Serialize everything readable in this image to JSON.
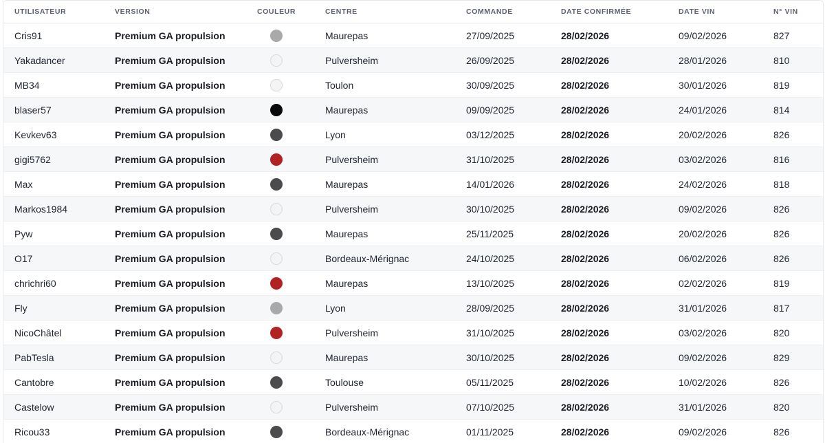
{
  "columns": {
    "utilisateur": "UTILISATEUR",
    "version": "VERSION",
    "couleur": "COULEUR",
    "centre": "CENTRE",
    "commande": "COMMANDE",
    "date_confirmee": "DATE CONFIRMÉE",
    "date_vin": "DATE VIN",
    "num_vin": "N° VIN"
  },
  "colors": {
    "argent": "#a9a9a9",
    "blanc": "#f4f4f4",
    "noir": "#0a0a0a",
    "gris": "#4b4b4d",
    "rouge": "#b22222"
  },
  "rows": [
    {
      "user": "Cris91",
      "version": "Premium GA propulsion",
      "color": "argent",
      "centre": "Maurepas",
      "commande": "27/09/2025",
      "confirmee": "28/02/2026",
      "date_vin": "09/02/2026",
      "vin": "827"
    },
    {
      "user": "Yakadancer",
      "version": "Premium GA propulsion",
      "color": "blanc",
      "centre": "Pulversheim",
      "commande": "26/09/2025",
      "confirmee": "28/02/2026",
      "date_vin": "28/01/2026",
      "vin": "810"
    },
    {
      "user": "MB34",
      "version": "Premium GA propulsion",
      "color": "blanc",
      "centre": "Toulon",
      "commande": "30/09/2025",
      "confirmee": "28/02/2026",
      "date_vin": "30/01/2026",
      "vin": "819"
    },
    {
      "user": "blaser57",
      "version": "Premium GA propulsion",
      "color": "noir",
      "centre": "Maurepas",
      "commande": "09/09/2025",
      "confirmee": "28/02/2026",
      "date_vin": "24/01/2026",
      "vin": "814"
    },
    {
      "user": "Kevkev63",
      "version": "Premium GA propulsion",
      "color": "gris",
      "centre": "Lyon",
      "commande": "03/12/2025",
      "confirmee": "28/02/2026",
      "date_vin": "20/02/2026",
      "vin": "826"
    },
    {
      "user": "gigi5762",
      "version": "Premium GA propulsion",
      "color": "rouge",
      "centre": "Pulversheim",
      "commande": "31/10/2025",
      "confirmee": "28/02/2026",
      "date_vin": "03/02/2026",
      "vin": "816"
    },
    {
      "user": "Max",
      "version": "Premium GA propulsion",
      "color": "gris",
      "centre": "Maurepas",
      "commande": "14/01/2026",
      "confirmee": "28/02/2026",
      "date_vin": "24/02/2026",
      "vin": "818"
    },
    {
      "user": "Markos1984",
      "version": "Premium GA propulsion",
      "color": "blanc",
      "centre": "Pulversheim",
      "commande": "30/10/2025",
      "confirmee": "28/02/2026",
      "date_vin": "09/02/2026",
      "vin": "826"
    },
    {
      "user": "Pyw",
      "version": "Premium GA propulsion",
      "color": "gris",
      "centre": "Maurepas",
      "commande": "25/11/2025",
      "confirmee": "28/02/2026",
      "date_vin": "20/02/2026",
      "vin": "826"
    },
    {
      "user": "O17",
      "version": "Premium GA propulsion",
      "color": "blanc",
      "centre": "Bordeaux-Mérignac",
      "commande": "24/10/2025",
      "confirmee": "28/02/2026",
      "date_vin": "06/02/2026",
      "vin": "826"
    },
    {
      "user": "chrichri60",
      "version": "Premium GA propulsion",
      "color": "rouge",
      "centre": "Maurepas",
      "commande": "13/10/2025",
      "confirmee": "28/02/2026",
      "date_vin": "02/02/2026",
      "vin": "819"
    },
    {
      "user": "Fly",
      "version": "Premium GA propulsion",
      "color": "argent",
      "centre": "Lyon",
      "commande": "28/09/2025",
      "confirmee": "28/02/2026",
      "date_vin": "31/01/2026",
      "vin": "817"
    },
    {
      "user": "NicoChâtel",
      "version": "Premium GA propulsion",
      "color": "rouge",
      "centre": "Pulversheim",
      "commande": "31/10/2025",
      "confirmee": "28/02/2026",
      "date_vin": "03/02/2026",
      "vin": "820"
    },
    {
      "user": "PabTesla",
      "version": "Premium GA propulsion",
      "color": "blanc",
      "centre": "Maurepas",
      "commande": "30/10/2025",
      "confirmee": "28/02/2026",
      "date_vin": "09/02/2026",
      "vin": "829"
    },
    {
      "user": "Cantobre",
      "version": "Premium GA propulsion",
      "color": "gris",
      "centre": "Toulouse",
      "commande": "05/11/2025",
      "confirmee": "28/02/2026",
      "date_vin": "10/02/2026",
      "vin": "826"
    },
    {
      "user": "Castelow",
      "version": "Premium GA propulsion",
      "color": "blanc",
      "centre": "Pulversheim",
      "commande": "07/10/2025",
      "confirmee": "28/02/2026",
      "date_vin": "31/01/2026",
      "vin": "820"
    },
    {
      "user": "Ricou33",
      "version": "Premium GA propulsion",
      "color": "gris",
      "centre": "Bordeaux-Mérignac",
      "commande": "01/11/2025",
      "confirmee": "28/02/2026",
      "date_vin": "09/02/2026",
      "vin": "826"
    }
  ]
}
